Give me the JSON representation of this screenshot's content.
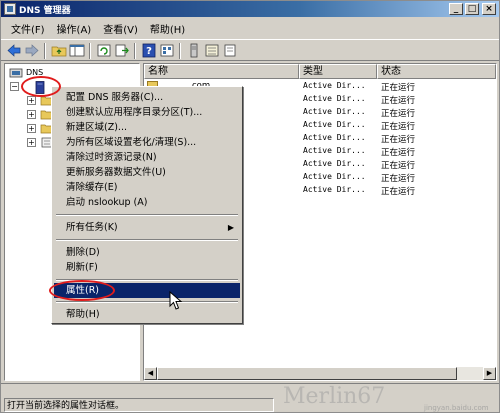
{
  "window": {
    "title": "DNS 管理器",
    "controls": {
      "minimize": "_",
      "maximize": "□",
      "close": "×"
    }
  },
  "menubar": {
    "items": [
      {
        "label": "文件(F)"
      },
      {
        "label": "操作(A)"
      },
      {
        "label": "查看(V)"
      },
      {
        "label": "帮助(H)"
      }
    ]
  },
  "toolbar": {
    "buttons": [
      "back-icon",
      "forward-icon",
      "up-folder-icon",
      "show-hide-tree-icon",
      "refresh-icon",
      "export-list-icon",
      "help-icon",
      "properties-icon",
      "server-icon",
      "zone-icon",
      "record-icon"
    ]
  },
  "tree": {
    "root": {
      "label": "DNS"
    },
    "server": {
      "label": ""
    }
  },
  "list": {
    "columns": [
      "名称",
      "类型",
      "状态"
    ],
    "rows": [
      {
        "name": "com",
        "type": "Active Dir...",
        "status": "正在运行"
      },
      {
        "name": "",
        "type": "Active Dir...",
        "status": "正在运行"
      },
      {
        "name": "",
        "type": "Active Dir...",
        "status": "正在运行"
      },
      {
        "name": "",
        "type": "Active Dir...",
        "status": "正在运行"
      },
      {
        "name": "",
        "type": "Active Dir...",
        "status": "正在运行"
      },
      {
        "name": "",
        "type": "Active Dir...",
        "status": "正在运行"
      },
      {
        "name": "",
        "type": "Active Dir...",
        "status": "正在运行"
      },
      {
        "name": "",
        "type": "Active Dir...",
        "status": "正在运行"
      },
      {
        "name": "",
        "type": "Active Dir...",
        "status": "正在运行"
      }
    ]
  },
  "context_menu": {
    "items": [
      {
        "label": "配置 DNS 服务器(C)..."
      },
      {
        "label": "创建默认应用程序目录分区(T)..."
      },
      {
        "label": "新建区域(Z)..."
      },
      {
        "label": "为所有区域设置老化/清理(S)..."
      },
      {
        "label": "清除过时资源记录(N)"
      },
      {
        "label": "更新服务器数据文件(U)"
      },
      {
        "label": "清除缓存(E)"
      },
      {
        "label": "启动 nslookup (A)"
      },
      {
        "label": "所有任务(K)"
      },
      {
        "label": "删除(D)"
      },
      {
        "label": "刷新(F)"
      },
      {
        "label": "属性(R)"
      },
      {
        "label": "帮助(H)"
      }
    ],
    "submenu_arrow": "▶"
  },
  "statusbar": {
    "text": "打开当前选择的属性对话框。"
  },
  "watermark": {
    "text": "Merlin67",
    "sub": "jingyan.baidu.com"
  },
  "colors": {
    "title_active": "#0a246a",
    "menu_highlight": "#0a246a",
    "annotation": "#e01c1c",
    "chrome": "#d4d0c8"
  }
}
